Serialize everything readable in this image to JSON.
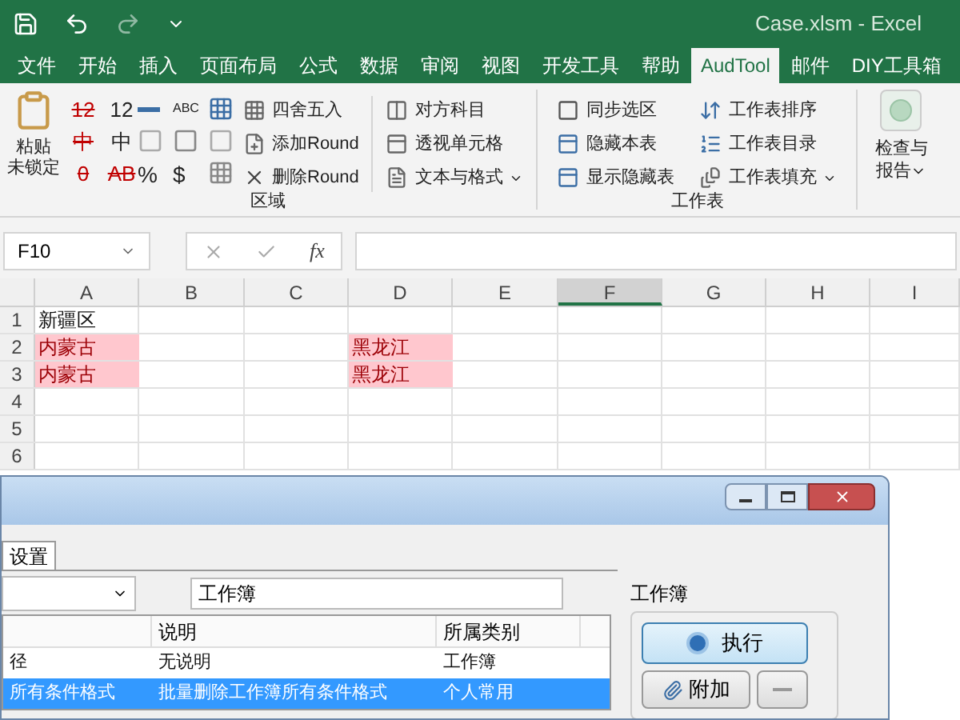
{
  "window": {
    "title": "Case.xlsm  -  Excel"
  },
  "ribbon_tabs": [
    {
      "label": "文件",
      "selected": false
    },
    {
      "label": "开始",
      "selected": false
    },
    {
      "label": "插入",
      "selected": false
    },
    {
      "label": "页面布局",
      "selected": false
    },
    {
      "label": "公式",
      "selected": false
    },
    {
      "label": "数据",
      "selected": false
    },
    {
      "label": "审阅",
      "selected": false
    },
    {
      "label": "视图",
      "selected": false
    },
    {
      "label": "开发工具",
      "selected": false
    },
    {
      "label": "帮助",
      "selected": false
    },
    {
      "label": "AudTool",
      "selected": true
    },
    {
      "label": "邮件",
      "selected": false
    },
    {
      "label": "DIY工具箱",
      "selected": false
    }
  ],
  "ribbon": {
    "paste": {
      "line1": "粘贴",
      "line2": "未锁定"
    },
    "glyph_grid": [
      {
        "text": "12",
        "struck": true
      },
      {
        "text": "12",
        "struck": false
      },
      {
        "text": "中",
        "struck": true
      },
      {
        "text": "中",
        "struck": false
      },
      {
        "text": "0",
        "struck": true
      },
      {
        "text": "AB",
        "struck": true
      }
    ],
    "abc_label": "ABC",
    "symbols": [
      {
        "text": "%"
      },
      {
        "text": "$"
      }
    ],
    "round_buttons": [
      {
        "label": "四舍五入",
        "kind": "grid"
      },
      {
        "label": "添加Round",
        "kind": "page"
      },
      {
        "label": "删除Round",
        "kind": "cross"
      }
    ],
    "cell_buttons": [
      {
        "label": "对方科目",
        "dropdown": false
      },
      {
        "label": "透视单元格",
        "dropdown": false
      },
      {
        "label": "文本与格式",
        "dropdown": true
      }
    ],
    "group_1": "区域",
    "sheet_buttons": [
      {
        "label": "同步选区",
        "dropdown": false
      },
      {
        "label": "隐藏本表",
        "dropdown": false
      },
      {
        "label": "显示隐藏表",
        "dropdown": false
      }
    ],
    "sheet_buttons_2": [
      {
        "label": "工作表排序",
        "dropdown": false
      },
      {
        "label": "工作表目录",
        "dropdown": false
      },
      {
        "label": "工作表填充",
        "dropdown": true
      }
    ],
    "group_2": "工作表",
    "check": {
      "line1": "检查与",
      "line2": "报告",
      "dropdown": true
    }
  },
  "formula_bar": {
    "name_box": "F10",
    "fx": "fx"
  },
  "sheet": {
    "columns": [
      {
        "label": "A",
        "selected": false
      },
      {
        "label": "B",
        "selected": false
      },
      {
        "label": "C",
        "selected": false
      },
      {
        "label": "D",
        "selected": false
      },
      {
        "label": "E",
        "selected": false
      },
      {
        "label": "F",
        "selected": true
      },
      {
        "label": "G",
        "selected": false
      },
      {
        "label": "H",
        "selected": false
      },
      {
        "label": "I",
        "selected": false
      }
    ],
    "rows": [
      {
        "label": "1",
        "cells": {
          "A": {
            "text": "新疆区",
            "highlighted": false
          }
        }
      },
      {
        "label": "2",
        "cells": {
          "A": {
            "text": "内蒙古",
            "highlighted": true
          },
          "D": {
            "text": "黑龙江",
            "highlighted": true
          }
        }
      },
      {
        "label": "3",
        "cells": {
          "A": {
            "text": "内蒙古",
            "highlighted": true
          },
          "D": {
            "text": "黑龙江",
            "highlighted": true
          }
        }
      },
      {
        "label": "4"
      },
      {
        "label": "5"
      },
      {
        "label": "6"
      }
    ]
  },
  "dialog": {
    "tab": "设置",
    "name_field": "工作簿",
    "group": "工作簿",
    "run_button": "执行",
    "attach_button": "附加",
    "columns": [
      "说明",
      "所属类别"
    ],
    "rows": [
      {
        "column_1": "径",
        "description": "无说明",
        "category": "工作簿",
        "selected": false
      },
      {
        "column_1": "所有条件格式",
        "description": "批量删除工作簿所有条件格式",
        "category": "个人常用",
        "selected": true
      }
    ]
  }
}
